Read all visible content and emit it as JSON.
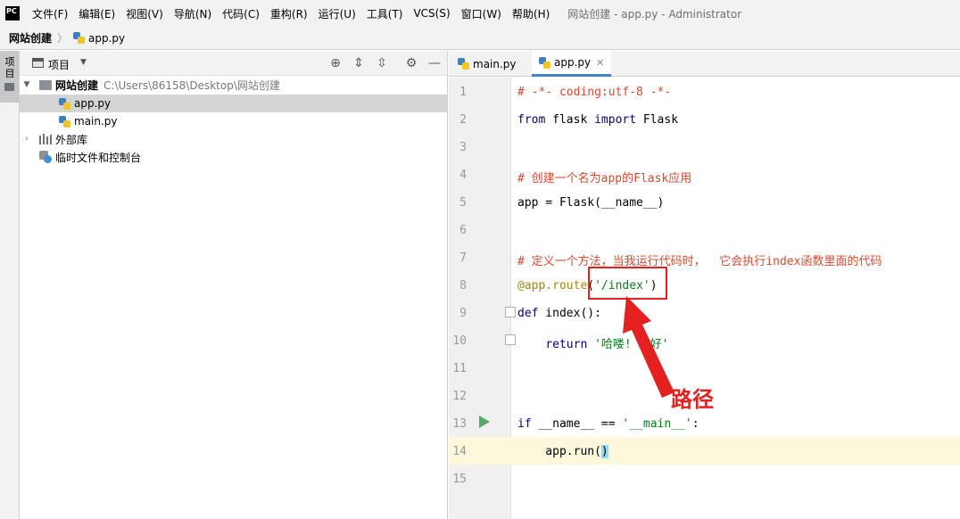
{
  "menubar": {
    "logo_text": "PC",
    "items": [
      "文件(F)",
      "编辑(E)",
      "视图(V)",
      "导航(N)",
      "代码(C)",
      "重构(R)",
      "运行(U)",
      "工具(T)",
      "VCS(S)",
      "窗口(W)",
      "帮助(H)"
    ],
    "window_title": "网站创建 - app.py - Administrator"
  },
  "breadcrumb": {
    "project": "网站创建",
    "file": "app.py"
  },
  "left_strip": {
    "label": "项目"
  },
  "project_panel": {
    "title": "项目",
    "tree": {
      "root_name": "网站创建",
      "root_path": "C:\\Users\\86158\\Desktop\\网站创建",
      "files": [
        "app.py",
        "main.py"
      ],
      "external_libraries": "外部库",
      "scratches": "临时文件和控制台"
    }
  },
  "editor": {
    "tabs": [
      {
        "label": "main.py",
        "active": false
      },
      {
        "label": "app.py",
        "active": true
      }
    ],
    "line_numbers": [
      "1",
      "2",
      "3",
      "4",
      "5",
      "6",
      "7",
      "8",
      "9",
      "10",
      "11",
      "12",
      "13",
      "14",
      "15"
    ],
    "code": {
      "l1": "# -*- coding:utf-8 -*-",
      "l2_kw1": "from",
      "l2_mid": " flask ",
      "l2_kw2": "import",
      "l2_end": " Flask",
      "l4": "# 创建一个名为app的Flask应用",
      "l5": "app = Flask(__name__)",
      "l7": "# 定义一个方法，当我运行代码时，  它会执行index函数里面的代码",
      "l8_deco": "@app.route",
      "l8_open": "(",
      "l8_str": "'/index'",
      "l8_close": ")",
      "l9_kw": "def",
      "l9_rest": " index():",
      "l10_indent": "    ",
      "l10_kw": "return",
      "l10_sp": " ",
      "l10_str": "'哈喽! 您好'",
      "l13_kw": "if",
      "l13_mid": " __name__ == ",
      "l13_str": "'__main__'",
      "l13_end": ":",
      "l14_text": "    app.run(",
      "l14_close": ")"
    }
  },
  "annotation": {
    "label": "路径",
    "color": "#e52020"
  },
  "colors": {
    "comment": "#d54a30",
    "keyword": "#000080",
    "string": "#067d17",
    "decorator": "#9e880d",
    "accent": "#4083c9"
  }
}
